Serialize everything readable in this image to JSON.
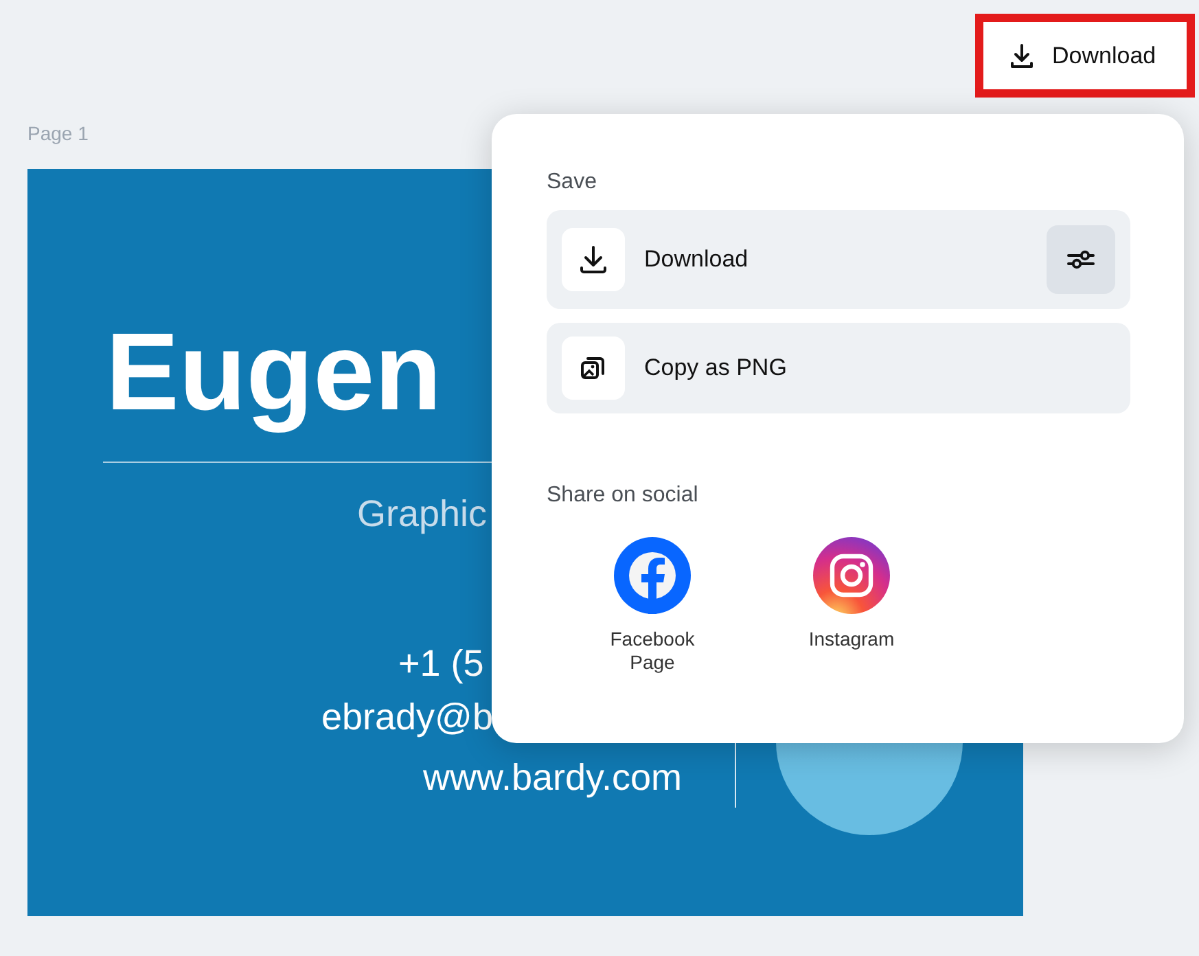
{
  "toolbar": {
    "download_button": {
      "label": "Download",
      "highlighted": true
    }
  },
  "page": {
    "label": "Page 1",
    "card": {
      "name": "Eugen",
      "title": "Graphic",
      "phone": "+1 (5",
      "email": "ebrady@b",
      "website": "www.bardy.com"
    }
  },
  "download_menu": {
    "save_heading": "Save",
    "save_options": [
      {
        "kind": "download",
        "label": "Download",
        "has_settings": true
      },
      {
        "kind": "copy",
        "label": "Copy as PNG",
        "has_settings": false
      }
    ],
    "share_heading": "Share on social",
    "share_targets": [
      {
        "kind": "facebook",
        "label": "Facebook Page"
      },
      {
        "kind": "instagram",
        "label": "Instagram"
      }
    ]
  }
}
